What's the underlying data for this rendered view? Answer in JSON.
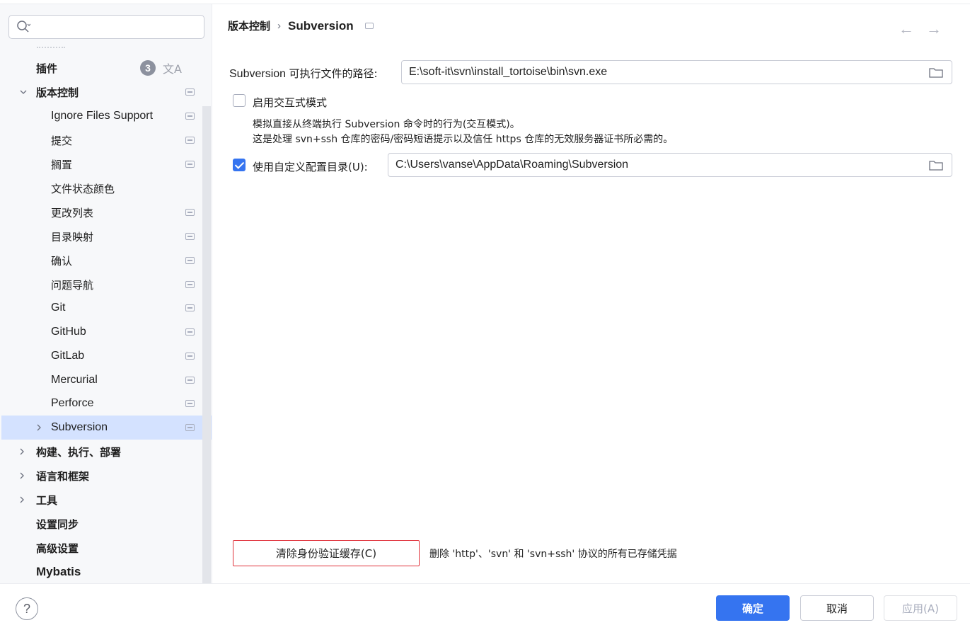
{
  "sidebar": {
    "search": {
      "placeholder": ""
    },
    "items": [
      {
        "label": "插件",
        "badge": "3",
        "translate_icon": "文A"
      },
      {
        "label": "版本控制"
      },
      {
        "label": "Ignore Files Support"
      },
      {
        "label": "提交"
      },
      {
        "label": "搁置"
      },
      {
        "label": "文件状态颜色"
      },
      {
        "label": "更改列表"
      },
      {
        "label": "目录映射"
      },
      {
        "label": "确认"
      },
      {
        "label": "问题导航"
      },
      {
        "label": "Git"
      },
      {
        "label": "GitHub"
      },
      {
        "label": "GitLab"
      },
      {
        "label": "Mercurial"
      },
      {
        "label": "Perforce"
      },
      {
        "label": "Subversion"
      },
      {
        "label": "构建、执行、部署"
      },
      {
        "label": "语言和框架"
      },
      {
        "label": "工具"
      },
      {
        "label": "设置同步"
      },
      {
        "label": "高级设置"
      },
      {
        "label": "Mybatis"
      }
    ]
  },
  "header": {
    "breadcrumb": [
      "版本控制",
      "Subversion"
    ],
    "back_arrow": "←",
    "forward_arrow": "→"
  },
  "main": {
    "exe_path_label_prefix": "Subversion",
    "exe_path_label_suffix": "可执行文件的路径:",
    "exe_path_value": "E:\\soft-it\\svn\\install_tortoise\\bin\\svn.exe",
    "interactive_mode_label": "启用交互式模式",
    "interactive_mode_checked": false,
    "interactive_desc_line1": "模拟直接从终端执行 Subversion 命令时的行为(交互模式)。",
    "interactive_desc_line2": "这是处理 svn+ssh 仓库的密码/密码短语提示以及信任 https 仓库的无效服务器证书所必需的。",
    "custom_config_label": "使用自定义配置目录(U):",
    "custom_config_checked": true,
    "custom_config_value": "C:\\Users\\vanse\\AppData\\Roaming\\Subversion",
    "clear_cache_button": "清除身份验证缓存(C)",
    "clear_cache_desc": "删除 'http'、'svn' 和 'svn+ssh' 协议的所有已存储凭据"
  },
  "footer": {
    "help": "?",
    "ok": "确定",
    "cancel": "取消",
    "apply": "应用(A)"
  },
  "colors": {
    "accent": "#3574f0",
    "selection": "#d4e2ff",
    "highlight_border": "#e0313a"
  }
}
